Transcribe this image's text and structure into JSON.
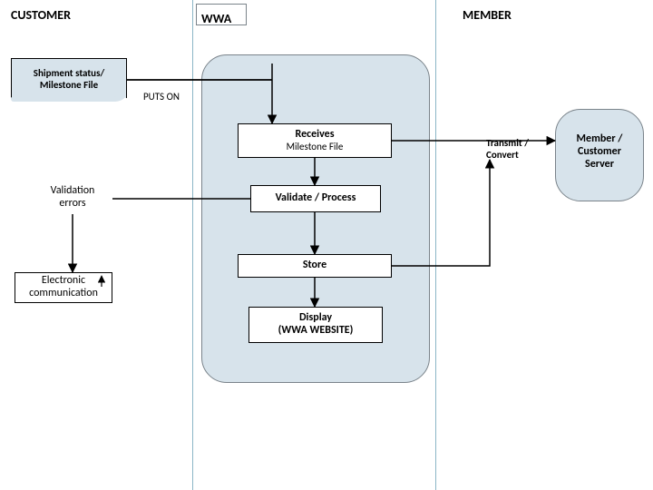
{
  "lanes": {
    "customer": "CUSTOMER",
    "wwa": "WWA",
    "member": "MEMBER"
  },
  "nodes": {
    "shipment_doc": {
      "line1": "Shipment status/",
      "line2": "Milestone File"
    },
    "puts_on": "PUTS ON",
    "receives": {
      "line1": "Receives",
      "line2": "Milestone File"
    },
    "validate": "Validate / Process",
    "store": "Store",
    "display": {
      "line1": "Display",
      "line2": "(WWA WEBSITE)"
    },
    "validation_errors": {
      "line1": "Validation",
      "line2": "errors"
    },
    "elec_comm": {
      "line1": "Electronic",
      "line2": "communication"
    },
    "transmit": {
      "line1": "Transmit /",
      "line2": "Convert"
    },
    "member_server": {
      "line1": "Member /",
      "line2": "Customer",
      "line3": "Server"
    }
  },
  "chart_data": {
    "type": "diagram",
    "title": "Shipment status / Milestone file flow",
    "swimlanes": [
      "CUSTOMER",
      "WWA",
      "MEMBER"
    ],
    "nodes": [
      {
        "id": "shipment_doc",
        "lane": "CUSTOMER",
        "label": "Shipment status / Milestone File",
        "shape": "document"
      },
      {
        "id": "validation_errors",
        "lane": "CUSTOMER",
        "label": "Validation errors",
        "shape": "process"
      },
      {
        "id": "elec_comm",
        "lane": "CUSTOMER",
        "label": "Electronic communication",
        "shape": "process"
      },
      {
        "id": "receives",
        "lane": "WWA",
        "label": "Receives Milestone File",
        "shape": "process"
      },
      {
        "id": "validate",
        "lane": "WWA",
        "label": "Validate / Process",
        "shape": "process"
      },
      {
        "id": "store",
        "lane": "WWA",
        "label": "Store",
        "shape": "process"
      },
      {
        "id": "display",
        "lane": "WWA",
        "label": "Display (WWA WEBSITE)",
        "shape": "process"
      },
      {
        "id": "transmit",
        "lane": "MEMBER",
        "label": "Transmit / Convert",
        "shape": "text"
      },
      {
        "id": "member_server",
        "lane": "MEMBER",
        "label": "Member / Customer Server",
        "shape": "process"
      }
    ],
    "edges": [
      {
        "from": "shipment_doc",
        "to": "receives",
        "label": "PUTS ON"
      },
      {
        "from": "receives",
        "to": "validate"
      },
      {
        "from": "validate",
        "to": "store"
      },
      {
        "from": "store",
        "to": "display"
      },
      {
        "from": "validate",
        "to": "validation_errors"
      },
      {
        "from": "validation_errors",
        "to": "elec_comm"
      },
      {
        "from": "receives",
        "to": "member_server",
        "label": "Transmit / Convert"
      },
      {
        "from": "store",
        "to": "member_server"
      }
    ]
  }
}
